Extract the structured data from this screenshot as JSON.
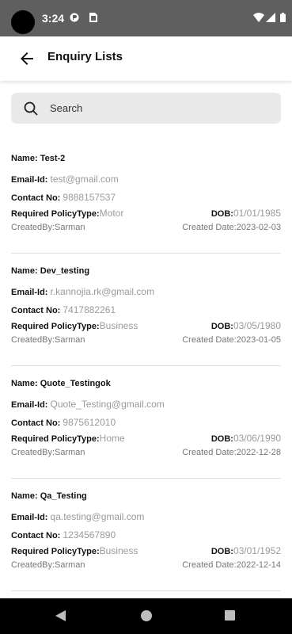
{
  "status_bar": {
    "time": "3:24",
    "icons": [
      "camera-dot",
      "vpn-icon",
      "sim-icon",
      "wifi-icon",
      "signal-icon",
      "battery-icon"
    ]
  },
  "app_bar": {
    "title": "Enquiry Lists",
    "back_icon": "arrow-left-icon"
  },
  "search": {
    "placeholder": "Search",
    "icon": "search-icon"
  },
  "labels": {
    "name": "Name: ",
    "email": "Email-Id: ",
    "contact": "Contact No: ",
    "policy_type": "Required PolicyType:",
    "dob": "DOB:",
    "created_by": "CreatedBy:",
    "created_date": "Created Date:"
  },
  "enquiries": [
    {
      "name": "Test-2",
      "email": "test@gmail.com",
      "contact": "9888157537",
      "policy_type": "Motor",
      "dob": "01/01/1985",
      "created_by": "Sarman",
      "created_date": "2023-02-03"
    },
    {
      "name": "Dev_testing",
      "email": "r.kannojia.rk@gmail.com",
      "contact": "7417882261",
      "policy_type": "Business",
      "dob": "03/05/1980",
      "created_by": "Sarman",
      "created_date": "2023-01-05"
    },
    {
      "name": "Quote_Testingok",
      "email": "Quote_Testing@gmail.com",
      "contact": "9875612010",
      "policy_type": "Home",
      "dob": "03/06/1990",
      "created_by": "Sarman",
      "created_date": "2022-12-28"
    },
    {
      "name": "Qa_Testing",
      "email": "qa.testing@gmail.com",
      "contact": "1234567890",
      "policy_type": "Business",
      "dob": "03/01/1952",
      "created_by": "Sarman",
      "created_date": "2022-12-14"
    }
  ],
  "nav_bar": {
    "icons": [
      "nav-back-icon",
      "nav-home-icon",
      "nav-recents-icon"
    ]
  },
  "colors": {
    "status_bar": "#5f5f5f",
    "search_bg": "#e9e9e9",
    "value_grey": "#9a9a9a",
    "nav_bar": "#000000"
  }
}
